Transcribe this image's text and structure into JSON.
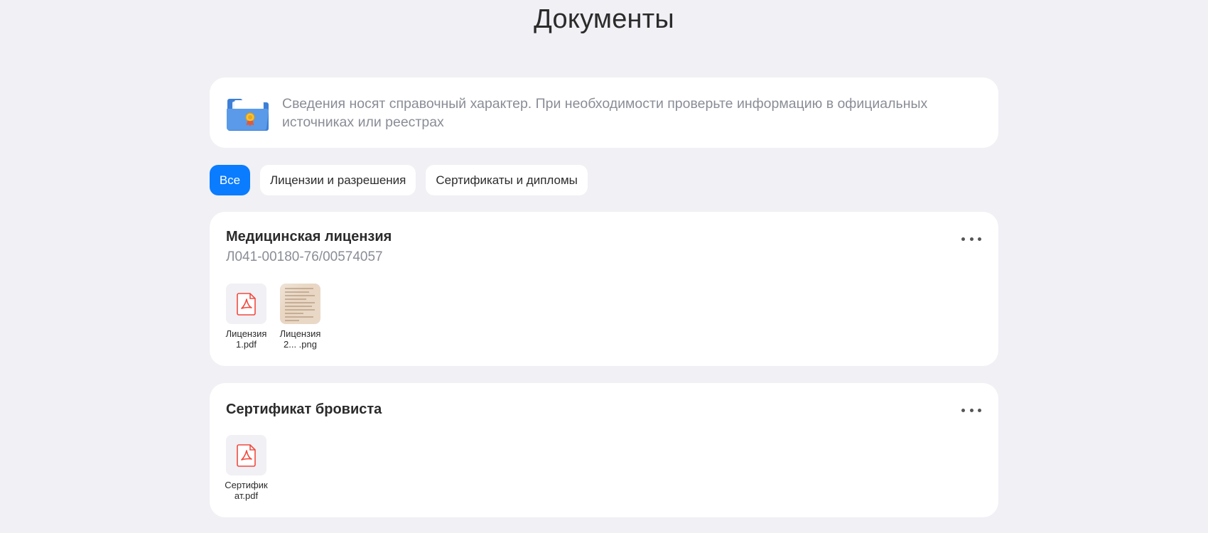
{
  "page_title": "Документы",
  "info_banner": {
    "icon": "folder-certificate-icon",
    "text": "Сведения носят справочный характер. При необходимости проверьте информацию в официальных источниках или реестрах"
  },
  "tabs": [
    {
      "label": "Все",
      "active": true
    },
    {
      "label": "Лицензии и разрешения",
      "active": false
    },
    {
      "label": "Сертификаты и дипломы",
      "active": false
    }
  ],
  "colors": {
    "background": "#f0f0f5",
    "accent": "#0a7cff",
    "muted_text": "#8a8d96",
    "pdf_red": "#f04a3e"
  },
  "documents": [
    {
      "title": "Медицинская лицензия",
      "subtitle": "Л041-00180-76/00574057",
      "files": [
        {
          "name": "Лицензия1.pdf",
          "type": "pdf"
        },
        {
          "name": "Лицензия2... .png",
          "type": "png"
        }
      ]
    },
    {
      "title": "Сертификат бровиста",
      "subtitle": "",
      "files": [
        {
          "name": "Сертификат.pdf",
          "type": "pdf"
        }
      ]
    }
  ]
}
